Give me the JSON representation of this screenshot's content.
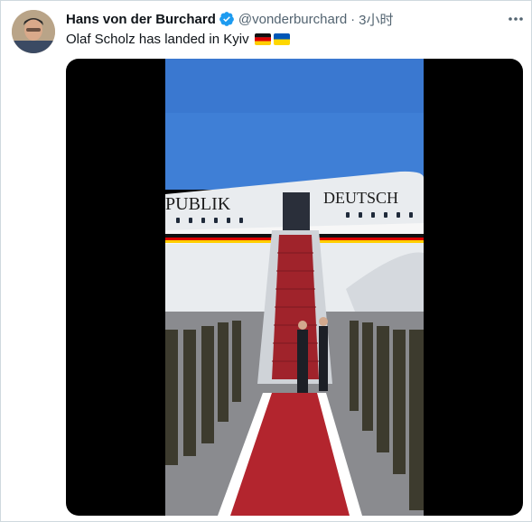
{
  "tweet": {
    "author_name": "Hans von der Burchard",
    "handle": "@vonderburchard",
    "separator": "·",
    "time": "3小时",
    "text": "Olaf Scholz has landed in Kyiv",
    "flags": [
      "germany-flag-icon",
      "ukraine-flag-icon"
    ]
  },
  "video": {
    "fuselage_text_left": "PUBLIK",
    "fuselage_text_right": "DEUTSCH"
  },
  "colors": {
    "verified_blue": "#1d9bf0",
    "sky": "#3f7fd6",
    "carpet": "#b3252e"
  }
}
